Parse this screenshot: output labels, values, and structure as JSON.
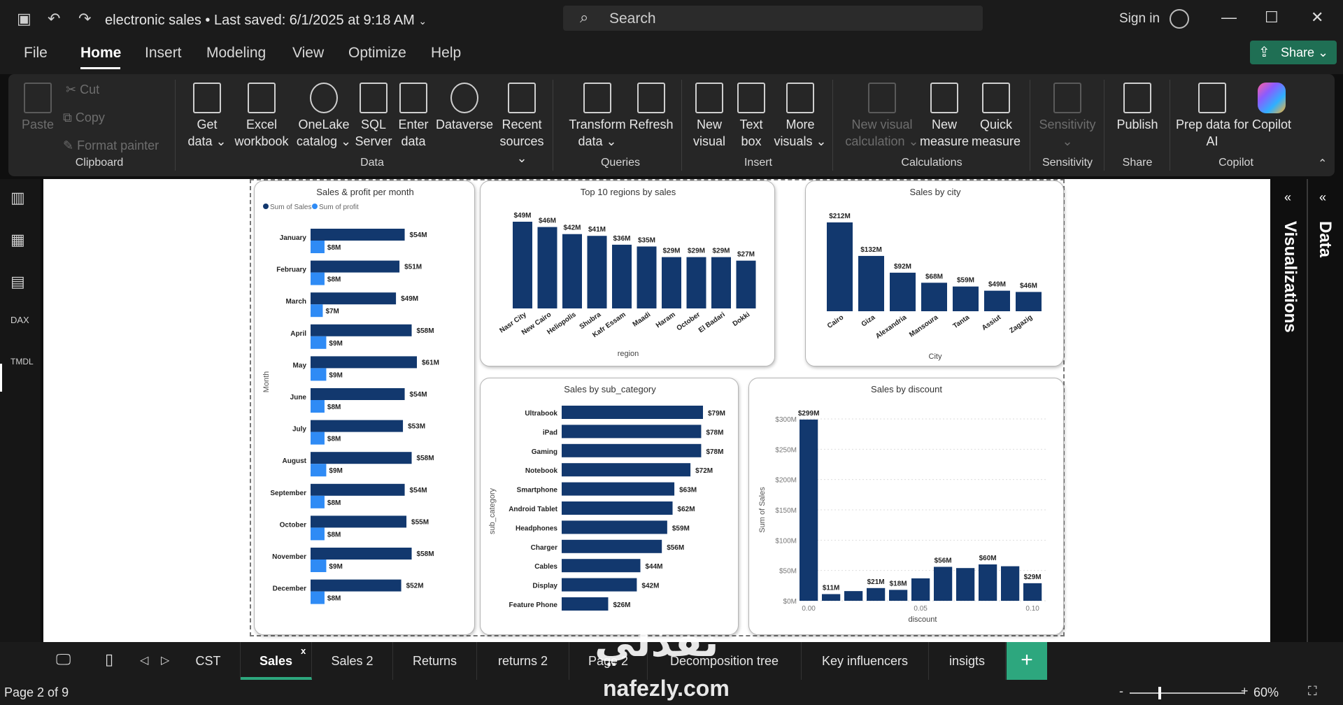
{
  "titlebar": {
    "document_title": "electronic sales",
    "saved_text": "• Last saved: 6/1/2025 at 9:18 AM",
    "search_placeholder": "Search",
    "sign_in": "Sign in"
  },
  "menu": {
    "items": [
      "File",
      "Home",
      "Insert",
      "Modeling",
      "View",
      "Optimize",
      "Help"
    ],
    "active": "Home",
    "share_label": "Share"
  },
  "ribbon": {
    "clipboard": {
      "paste": "Paste",
      "cut": "Cut",
      "copy": "Copy",
      "format_painter": "Format painter",
      "group_label": "Clipboard"
    },
    "data": {
      "get_data": [
        "Get",
        "data ⌄"
      ],
      "excel": [
        "Excel",
        "workbook"
      ],
      "onelake": [
        "OneLake",
        "catalog ⌄"
      ],
      "sql": [
        "SQL",
        "Server"
      ],
      "enter_data": [
        "Enter",
        "data"
      ],
      "dataverse": [
        "Dataverse",
        ""
      ],
      "recent_sources": [
        "Recent",
        "sources ⌄"
      ],
      "group_label": "Data"
    },
    "queries": {
      "transform": [
        "Transform",
        "data ⌄"
      ],
      "refresh": [
        "Refresh",
        ""
      ],
      "group_label": "Queries"
    },
    "insert": {
      "new_visual": [
        "New",
        "visual"
      ],
      "text_box": [
        "Text",
        "box"
      ],
      "more_visuals": [
        "More",
        "visuals ⌄"
      ],
      "group_label": "Insert"
    },
    "calculations": {
      "new_visual_calc": [
        "New visual",
        "calculation ⌄"
      ],
      "new_measure": [
        "New",
        "measure"
      ],
      "quick_measure": [
        "Quick",
        "measure"
      ],
      "group_label": "Calculations"
    },
    "sensitivity": {
      "label": [
        "Sensitivity",
        "⌄"
      ],
      "group_label": "Sensitivity"
    },
    "share": {
      "publish": [
        "Publish",
        ""
      ],
      "group_label": "Share"
    },
    "copilot": {
      "prep_data": [
        "Prep data for",
        "AI"
      ],
      "copilot": [
        "Copilot",
        ""
      ],
      "group_label": "Copilot"
    }
  },
  "panes": {
    "visualizations": "Visualizations",
    "data": "Data"
  },
  "tabs": [
    "CST",
    "Sales",
    "Sales 2",
    "Returns",
    "returns 2",
    "Page 2",
    "Decomposition tree",
    "Key influencers",
    "insigts"
  ],
  "active_tab": "Sales",
  "status": {
    "page": "Page 2 of 9",
    "zoom": "60%"
  },
  "watermark": {
    "arabic": "نفذلي",
    "latin": "nafezly.com"
  },
  "chart_data": [
    {
      "id": "month",
      "type": "bar",
      "orientation": "horizontal",
      "title": "Sales & profit per month",
      "ylabel": "Month",
      "legend": "top-left",
      "categories": [
        "January",
        "February",
        "March",
        "April",
        "May",
        "June",
        "July",
        "August",
        "September",
        "October",
        "November",
        "December"
      ],
      "series": [
        {
          "name": "Sum of Sales",
          "color": "#12386e",
          "values": [
            54,
            51,
            49,
            58,
            61,
            54,
            53,
            58,
            54,
            55,
            58,
            52
          ],
          "labels": [
            "$54M",
            "$51M",
            "$49M",
            "$58M",
            "$61M",
            "$54M",
            "$53M",
            "$58M",
            "$54M",
            "$55M",
            "$58M",
            "$52M"
          ]
        },
        {
          "name": "Sum of profit",
          "color": "#2f8bf5",
          "values": [
            8,
            8,
            7,
            9,
            9,
            8,
            8,
            9,
            8,
            8,
            9,
            8
          ],
          "labels": [
            "$8M",
            "$8M",
            "$7M",
            "$9M",
            "$9M",
            "$8M",
            "$8M",
            "$9M",
            "$8M",
            "$8M",
            "$9M",
            "$8M"
          ]
        }
      ],
      "xlim": [
        0,
        61
      ]
    },
    {
      "id": "region",
      "type": "bar",
      "title": "Top 10 regions by sales",
      "xlabel": "region",
      "categories": [
        "Nasr City",
        "New Cairo",
        "Heliopolis",
        "Shubra",
        "Kafr Essam",
        "Maadi",
        "Haram",
        "October",
        "El Badari",
        "Dokki"
      ],
      "values": [
        49,
        46,
        42,
        41,
        36,
        35,
        29,
        29,
        29,
        27
      ],
      "labels": [
        "$49M",
        "$46M",
        "$42M",
        "$41M",
        "$36M",
        "$35M",
        "$29M",
        "$29M",
        "$29M",
        "$27M"
      ],
      "color": "#12386e"
    },
    {
      "id": "city",
      "type": "bar",
      "title": "Sales by city",
      "xlabel": "City",
      "categories": [
        "Cairo",
        "Giza",
        "Alexandria",
        "Mansoura",
        "Tanta",
        "Assiut",
        "Zagazig"
      ],
      "values": [
        212,
        132,
        92,
        68,
        59,
        49,
        46
      ],
      "labels": [
        "$212M",
        "$132M",
        "$92M",
        "$68M",
        "$59M",
        "$49M",
        "$46M"
      ],
      "color": "#12386e"
    },
    {
      "id": "subcat",
      "type": "bar",
      "orientation": "horizontal",
      "title": "Sales by sub_category",
      "ylabel": "sub_category",
      "categories": [
        "Ultrabook",
        "iPad",
        "Gaming",
        "Notebook",
        "Smartphone",
        "Android Tablet",
        "Headphones",
        "Charger",
        "Cables",
        "Display",
        "Feature Phone"
      ],
      "values": [
        79,
        78,
        78,
        72,
        63,
        62,
        59,
        56,
        44,
        42,
        26
      ],
      "labels": [
        "$79M",
        "$78M",
        "$78M",
        "$72M",
        "$63M",
        "$62M",
        "$59M",
        "$56M",
        "$44M",
        "$42M",
        "$26M"
      ],
      "color": "#12386e"
    },
    {
      "id": "discount",
      "type": "bar",
      "title": "Sales by discount",
      "xlabel": "discount",
      "ylabel": "Sum of Sales",
      "x": [
        0.0,
        0.01,
        0.02,
        0.03,
        0.04,
        0.05,
        0.06,
        0.07,
        0.08,
        0.09,
        0.1
      ],
      "values": [
        299,
        11,
        16,
        21,
        18,
        37,
        56,
        54,
        60,
        57,
        29
      ],
      "labels": [
        "$299M",
        "$11M",
        "",
        "$21M",
        "$18M",
        "",
        "$56M",
        "",
        "$60M",
        "",
        "$29M"
      ],
      "yticks": [
        "$0M",
        "$50M",
        "$100M",
        "$150M",
        "$200M",
        "$250M",
        "$300M"
      ],
      "xticks": [
        "0.00",
        "0.05",
        "0.10"
      ],
      "ylim": [
        0,
        300
      ],
      "xlim": [
        0,
        0.1
      ],
      "color": "#12386e"
    }
  ]
}
